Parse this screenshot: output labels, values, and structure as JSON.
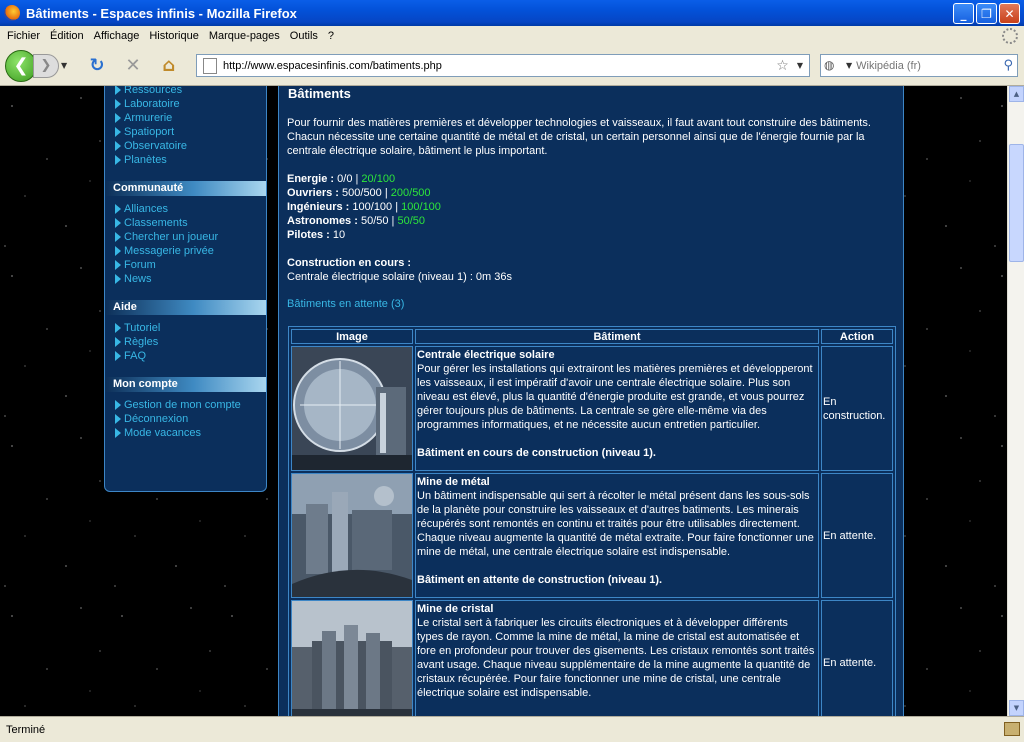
{
  "window": {
    "title": "Bâtiments - Espaces infinis - Mozilla Firefox"
  },
  "menubar": {
    "items": [
      "Fichier",
      "Édition",
      "Affichage",
      "Historique",
      "Marque-pages",
      "Outils",
      "?"
    ]
  },
  "navbar": {
    "url": "http://www.espacesinfinis.com/batiments.php",
    "search_placeholder": "Wikipédia (fr)"
  },
  "statusbar": {
    "text": "Terminé"
  },
  "sidebar": {
    "top_items": [
      "Ressources",
      "Laboratoire",
      "Armurerie",
      "Spatioport",
      "Observatoire",
      "Planètes"
    ],
    "sections": [
      {
        "title": "Communauté",
        "items": [
          "Alliances",
          "Classements",
          "Chercher un joueur",
          "Messagerie privée",
          "Forum",
          "News"
        ]
      },
      {
        "title": "Aide",
        "items": [
          "Tutoriel",
          "Règles",
          "FAQ"
        ]
      },
      {
        "title": "Mon compte",
        "items": [
          "Gestion de mon compte",
          "Déconnexion",
          "Mode vacances"
        ]
      }
    ]
  },
  "main": {
    "title": "Bâtiments",
    "intro": "Pour fournir des matières premières et développer technologies et vaisseaux, il faut avant tout construire des bâtiments. Chacun nécessite une certaine quantité de métal et de cristal, un certain personnel ainsi que de l'énergie fournie par la centrale électrique solaire, bâtiment le plus important.",
    "stats": [
      {
        "label": "Energie :",
        "value": "0/0",
        "sep": " | ",
        "extra": "20/100"
      },
      {
        "label": "Ouvriers :",
        "value": "500/500",
        "sep": " | ",
        "extra": "200/500"
      },
      {
        "label": "Ingénieurs :",
        "value": "100/100",
        "sep": " | ",
        "extra": "100/100"
      },
      {
        "label": "Astronomes :",
        "value": "50/50",
        "sep": " | ",
        "extra": "50/50"
      },
      {
        "label": "Pilotes :",
        "value": "10",
        "sep": "",
        "extra": ""
      }
    ],
    "construction_title": "Construction en cours :",
    "construction_text": "Centrale électrique solaire (niveau 1) : 0m 36s",
    "waiting_link": "Bâtiments en attente (3)",
    "table": {
      "headers": [
        "Image",
        "Bâtiment",
        "Action"
      ],
      "rows": [
        {
          "name": "Centrale électrique solaire",
          "desc": "Pour gérer les installations qui extrairont les matières premières et développeront les vaisseaux, il est impératif d'avoir une centrale électrique solaire. Plus son niveau est élevé, plus la quantité d'énergie produite est grande, et vous pourrez gérer toujours plus de bâtiments. La centrale se gère elle-même via des programmes informatiques, et ne nécessite aucun entretien particulier.",
          "status": "Bâtiment en cours de construction (niveau 1).",
          "action": "En construction."
        },
        {
          "name": "Mine de métal",
          "desc": "Un bâtiment indispensable qui sert à récolter le métal présent dans les sous-sols de la planète pour construire les vaisseaux et d'autres batiments. Les minerais récupérés sont remontés en continu et traités pour être utilisables directement. Chaque niveau augmente la quantité de métal extraite. Pour faire fonctionner une mine de métal, une centrale électrique solaire est indispensable.",
          "status": "Bâtiment en attente de construction (niveau 1).",
          "action": "En attente."
        },
        {
          "name": "Mine de cristal",
          "desc": "Le cristal sert à fabriquer les circuits électroniques et à développer différents types de rayon. Comme la mine de métal, la mine de cristal est automatisée et fore en profondeur pour trouver des gisements. Les cristaux remontés sont traités avant usage. Chaque niveau supplémentaire de la mine augmente la quantité de cristaux récupérée. Pour faire fonctionner une mine de cristal, une centrale électrique solaire est indispensable.",
          "status": "",
          "action": "En attente."
        }
      ]
    }
  }
}
